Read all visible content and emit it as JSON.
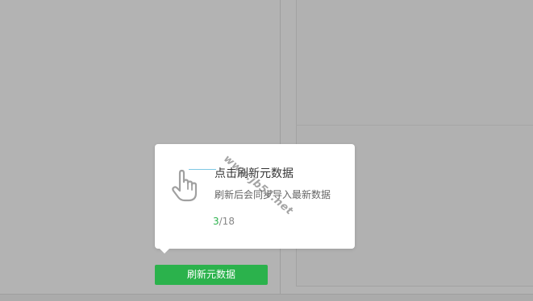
{
  "guide": {
    "title": "点击刷新元数据",
    "description": "刷新后会同步导入最新数据",
    "step_current": "3",
    "step_total": "/18",
    "icon": "hand-pointer-icon"
  },
  "actions": {
    "refresh_label": "刷新元数据"
  },
  "watermark": {
    "text": "www.jb51.net"
  },
  "colors": {
    "accent": "#2bb24c",
    "overlay": "#b3b3b3",
    "card": "#ffffff"
  }
}
